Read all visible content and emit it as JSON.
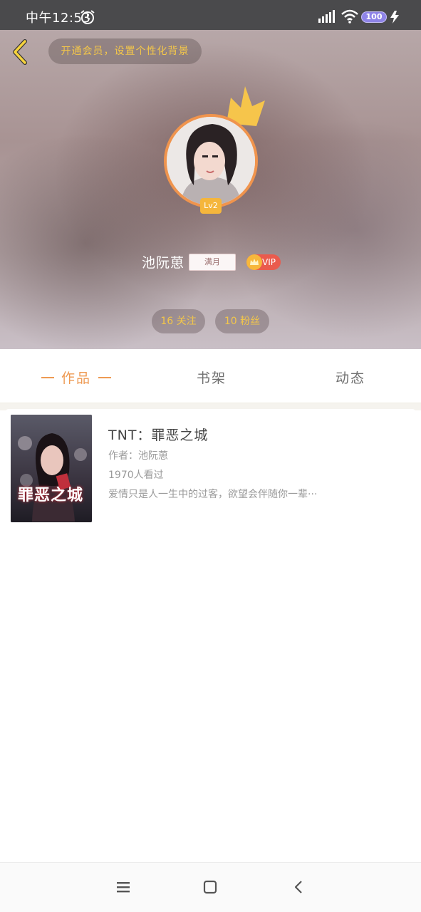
{
  "status_bar": {
    "time": "中午12:53",
    "battery": "100"
  },
  "header": {
    "vip_banner": "开通会员，设置个性化背景",
    "level": "Lv2",
    "username": "池阮葸",
    "name_tag": "满月",
    "vip_label": "VIP",
    "following": "16 关注",
    "fans": "10 粉丝"
  },
  "tabs": [
    {
      "label": "作品",
      "active": true
    },
    {
      "label": "书架",
      "active": false
    },
    {
      "label": "动态",
      "active": false
    }
  ],
  "books": [
    {
      "title": "TNT：罪恶之城",
      "author": "作者：池阮葸",
      "views": "1970人看过",
      "description": "爱情只是人一生中的过客，欲望会伴随你一辈···",
      "cover_text": "罪恶之城"
    }
  ],
  "colors": {
    "accent": "#ee9a53",
    "vip_gold": "#f3c64a",
    "vip_red": "#ea5b4d"
  }
}
